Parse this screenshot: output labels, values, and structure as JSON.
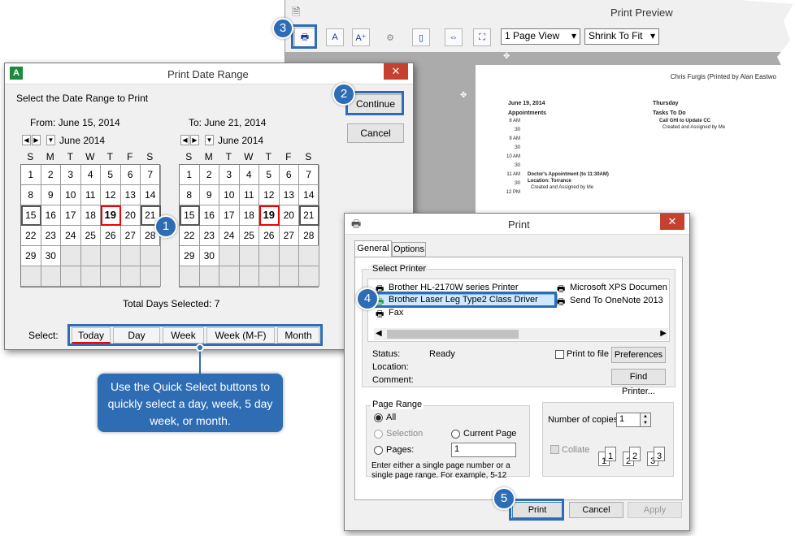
{
  "print_preview": {
    "title": "Print Preview",
    "zoom_select": "1 Page View",
    "fit_select": "Shrink To Fit",
    "page": {
      "header_name": "Chris Furgis (Printed by Alan Eastwo",
      "date": "June 19, 2014",
      "day": "Thursday",
      "appointments_label": "Appointments",
      "tasks_label": "Tasks To Do",
      "task_title": "Call GHI to Update CC",
      "task_sub": "Created and Assigned by Me",
      "times": [
        "8 AM",
        ":30",
        "9 AM",
        ":30",
        "10 AM",
        ":30",
        "11 AM",
        ":30",
        "12 PM"
      ],
      "appt_title": "Doctor's Appointment (to 11:30AM)",
      "appt_location": "Location: Torrance",
      "appt_sub": "Created and Assigned by Me"
    }
  },
  "date_range": {
    "title": "Print Date Range",
    "prompt": "Select the Date Range to Print",
    "from_label": "From: June 15, 2014",
    "to_label": "To: June 21, 2014",
    "month_label": "June 2014",
    "dow": [
      "S",
      "M",
      "T",
      "W",
      "T",
      "F",
      "S"
    ],
    "weeks": [
      [
        "1",
        "2",
        "3",
        "4",
        "5",
        "6",
        "7"
      ],
      [
        "8",
        "9",
        "10",
        "11",
        "12",
        "13",
        "14"
      ],
      [
        "15",
        "16",
        "17",
        "18",
        "19",
        "20",
        "21"
      ],
      [
        "22",
        "23",
        "24",
        "25",
        "26",
        "27",
        "28"
      ],
      [
        "29",
        "30",
        "",
        "",
        "",
        "",
        ""
      ],
      [
        "",
        "",
        "",
        "",
        "",
        "",
        ""
      ]
    ],
    "continue_label": "Continue",
    "cancel_label": "Cancel",
    "total_days": "Total Days Selected: 7",
    "select_label": "Select:",
    "quick_select": [
      "Today",
      "Day",
      "Week",
      "Week (M-F)",
      "Month"
    ]
  },
  "callouts": {
    "c1": "1",
    "c2": "2",
    "c3": "3",
    "c4": "4",
    "c5": "5",
    "tooltip": "Use the Quick Select buttons to quickly select a day, week, 5 day week, or month."
  },
  "print_dialog": {
    "title": "Print",
    "tabs": [
      "General",
      "Options"
    ],
    "select_printer_label": "Select Printer",
    "printers": [
      "Brother HL-2170W series Printer",
      "Brother Laser Leg Type2 Class Driver",
      "Fax",
      "Microsoft XPS Documen",
      "Send To OneNote 2013"
    ],
    "status_label": "Status:",
    "status_value": "Ready",
    "location_label": "Location:",
    "comment_label": "Comment:",
    "print_to_file": "Print to file",
    "preferences": "Preferences",
    "find_printer": "Find Printer...",
    "page_range_label": "Page Range",
    "all": "All",
    "selection": "Selection",
    "current_page": "Current Page",
    "pages": "Pages:",
    "pages_value": "1",
    "hint": "Enter either a single page number or a single page range.  For example, 5-12",
    "copies_label": "Number of copies:",
    "copies_value": "1",
    "collate": "Collate",
    "print_btn": "Print",
    "cancel_btn": "Cancel",
    "apply_btn": "Apply"
  },
  "colors": {
    "accent": "#2e6db4",
    "close": "#c6402f",
    "today_red": "#e00000"
  }
}
